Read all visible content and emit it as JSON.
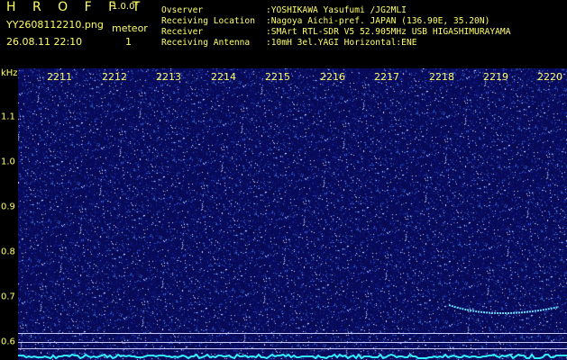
{
  "header": {
    "brand": "H R O F F T",
    "version": "1.0.0f",
    "filename": "YY2608112210.png",
    "meteor_label": "meteor",
    "timestamp": "26.08.11 22:10",
    "meteor_count": "1"
  },
  "meta": [
    {
      "label": "Ovserver",
      "value": ":YOSHIKAWA Yasufumi /JG2MLI"
    },
    {
      "label": "Receiving Location",
      "value": ":Nagoya Aichi-pref. JAPAN (136.90E, 35.20N)"
    },
    {
      "label": "Receiver",
      "value": ":SMArt RTL-SDR V5 52.905MHz USB HIGASHIMURAYAMA"
    },
    {
      "label": "Receiving Antenna",
      "value": ":10mH 3el.YAGI Horizontal:ENE"
    }
  ],
  "axes": {
    "y_title": "kHz",
    "x_ticks": [
      "2211",
      "2212",
      "2213",
      "2214",
      "2215",
      "2216",
      "2217",
      "2218",
      "2219",
      "2220"
    ],
    "y_ticks": [
      "1.1",
      "1.0",
      "0.9",
      "0.8",
      "0.7",
      "0.6"
    ]
  },
  "colors": {
    "text": "#ffff66",
    "background": "#0a0a4a",
    "echo": "#66ddff",
    "baseline": "#33eeff"
  }
}
